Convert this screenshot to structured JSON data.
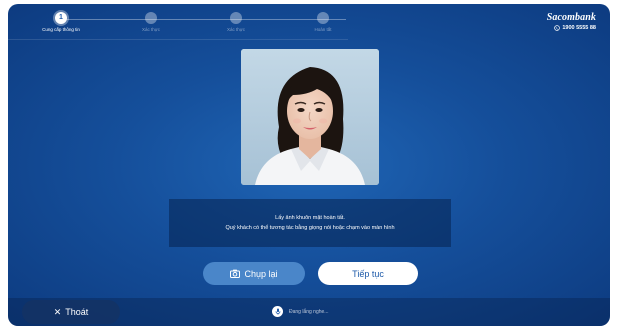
{
  "stepper": {
    "steps": [
      {
        "number": "1",
        "label": "Cung cấp thông tin",
        "active": true
      },
      {
        "number": "",
        "label": "Xác thực",
        "active": false
      },
      {
        "number": "",
        "label": "Xác thực",
        "active": false
      },
      {
        "number": "",
        "label": "Hoàn tất",
        "active": false
      }
    ]
  },
  "brand": {
    "name": "Sacombank",
    "hotline": "1900 5555 88"
  },
  "instruction": {
    "line1": "Lấy ảnh khuôn mặt hoàn tất.",
    "line2": "Quý khách có thể tương tác bằng giọng nói hoặc chạm vào màn hình"
  },
  "buttons": {
    "retake_label": "Chụp lại",
    "continue_label": "Tiếp tục",
    "exit_label": "Thoát"
  },
  "status": {
    "listening_text": "Đang lắng nghe..."
  },
  "colors": {
    "background": "#154f9b",
    "accent": "#1d5aa9",
    "retake_button": "#4a86c9"
  }
}
